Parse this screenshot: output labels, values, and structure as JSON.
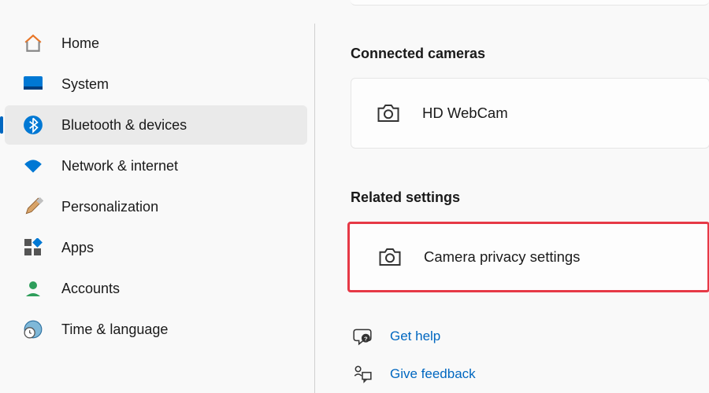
{
  "sidebar": {
    "items": [
      {
        "label": "Home",
        "icon": "home-icon",
        "active": false
      },
      {
        "label": "System",
        "icon": "system-icon",
        "active": false
      },
      {
        "label": "Bluetooth & devices",
        "icon": "bluetooth-icon",
        "active": true
      },
      {
        "label": "Network & internet",
        "icon": "wifi-icon",
        "active": false
      },
      {
        "label": "Personalization",
        "icon": "brush-icon",
        "active": false
      },
      {
        "label": "Apps",
        "icon": "apps-icon",
        "active": false
      },
      {
        "label": "Accounts",
        "icon": "user-icon",
        "active": false
      },
      {
        "label": "Time & language",
        "icon": "clock-globe-icon",
        "active": false
      }
    ]
  },
  "main": {
    "connected_title": "Connected cameras",
    "camera_name": "HD WebCam",
    "related_title": "Related settings",
    "privacy_label": "Camera privacy settings",
    "help_label": "Get help",
    "feedback_label": "Give feedback"
  },
  "colors": {
    "accent": "#0067c0",
    "highlight": "#e63946"
  }
}
